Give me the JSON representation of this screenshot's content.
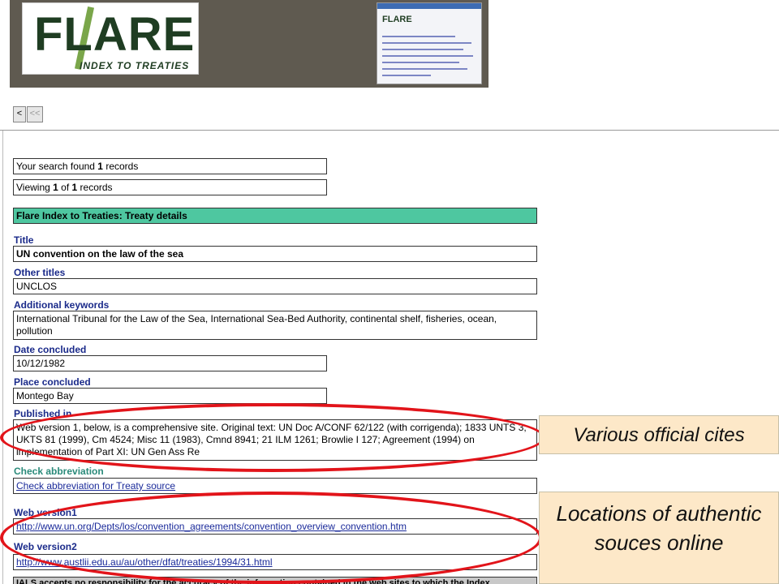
{
  "banner": {
    "logo_text": "FLARE",
    "logo_subtitle": "INDEX TO TREATIES",
    "thumbnail_title": "FLARE"
  },
  "nav": {
    "prev_label": "<",
    "first_label": "<<"
  },
  "results": {
    "found_prefix": "Your search found ",
    "found_count": "1",
    "found_suffix": " records",
    "viewing_prefix": "Viewing ",
    "viewing_current": "1",
    "viewing_of": " of ",
    "viewing_total": "1",
    "viewing_suffix": " records"
  },
  "section_header": "Flare Index to Treaties: Treaty details",
  "fields": {
    "title_label": "Title",
    "title_value": "UN convention on the law of the sea",
    "other_titles_label": "Other titles",
    "other_titles_value": "UNCLOS",
    "keywords_label": "Additional keywords",
    "keywords_value": "International Tribunal for the Law of the Sea, International Sea-Bed Authority, continental shelf, fisheries, ocean, pollution",
    "date_label": "Date concluded",
    "date_value": "10/12/1982",
    "place_label": "Place concluded",
    "place_value": "Montego Bay",
    "published_label": "Published in",
    "published_value": "Web version 1, below, is a comprehensive site. Original text: UN Doc A/CONF 62/122 (with corrigenda); 1833 UNTS 3; UKTS 81 (1999), Cm 4524; Misc 11 (1983), Cmnd 8941; 21 ILM 1261; Browlie I 127; Agreement (1994) on implementation of Part XI: UN Gen Ass Re",
    "check_abbrev_label": "Check abbreviation",
    "check_abbrev_link": "Check abbreviation for Treaty source",
    "web1_label": "Web version1",
    "web1_link": "http://www.un.org/Depts/los/convention_agreements/convention_overview_convention.htm",
    "web2_label": "Web version2",
    "web2_link": "http://www.austlii.edu.au/au/other/dfat/treaties/1994/31.html",
    "disclaimer": "IALS accepts no responsibility for the accuracy of the information contained in the web sites to which the Index"
  },
  "callouts": {
    "official_cites": "Various official cites",
    "authentic_sources": "Locations of authentic souces online"
  },
  "colors": {
    "header_bar": "#4ec7a0",
    "annotation_red": "#e2141a",
    "callout_bg": "#fde8c8"
  }
}
